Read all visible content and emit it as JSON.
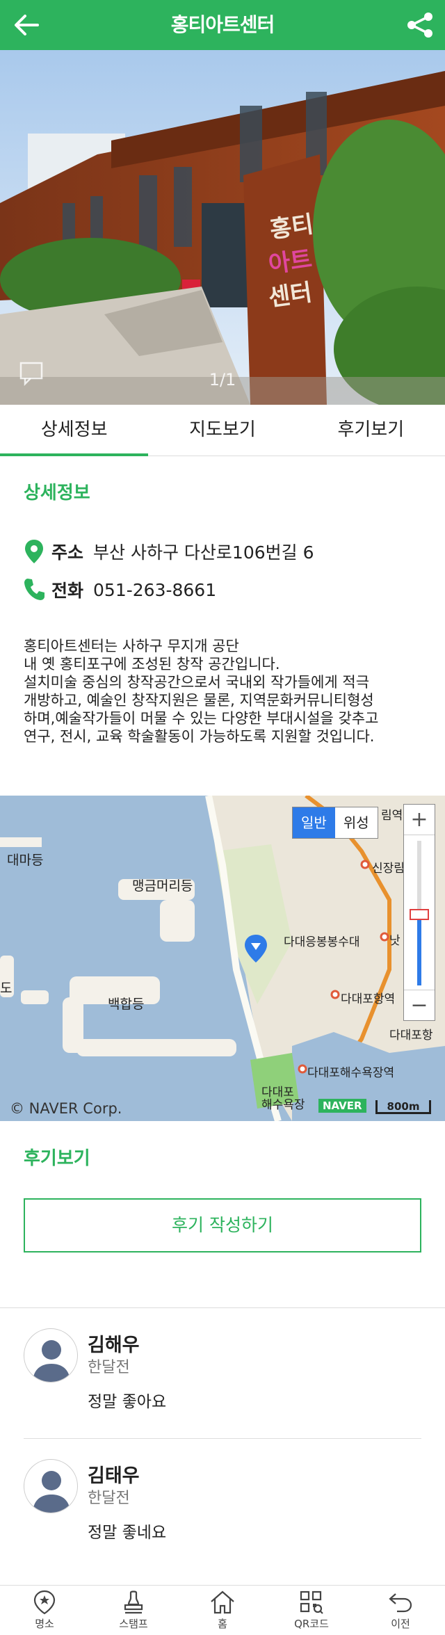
{
  "header": {
    "title": "홍티아트센터"
  },
  "hero": {
    "counter": "1/1",
    "sign_text": "홍티아트센터"
  },
  "tabs": [
    {
      "label": "상세정보"
    },
    {
      "label": "지도보기"
    },
    {
      "label": "후기보기"
    }
  ],
  "detail": {
    "section_title": "상세정보",
    "address_label": "주소",
    "address": "부산 사하구 다산로106번길 6",
    "phone_label": "전화",
    "phone": "051-263-8661",
    "description": "홍티아트센터는 사하구 무지개 공단\n내 옛 홍티포구에 조성된 창작 공간입니다.\n설치미술 중심의 창작공간으로서 국내외 작가들에게 적극\n개방하고, 예술인 창작지원은 물론, 지역문화커뮤니티형성\n하며,예술작가들이 머물 수 있는 다양한 부대시설을 갖추고\n연구, 전시, 교육 학술활동이 가능하도록 지원할 것입니다."
  },
  "map": {
    "toggle_normal": "일반",
    "toggle_satellite": "위성",
    "labels": {
      "daemado": "대마등",
      "maenggeum": "맹금머리등",
      "baekhap": "백합등",
      "do": "도",
      "bongsu": "다대응봉봉수대",
      "port": "다대포항역",
      "port2": "다대포항",
      "beach_station": "다대포해수욕장역",
      "beach": "다대포\n해수욕장",
      "sinjang": "신장림",
      "rimyeok": "림역",
      "nat": "낫"
    },
    "copyright": "© NAVER Corp.",
    "naver": "NAVER",
    "scale": "800m"
  },
  "reviews": {
    "section_title": "후기보기",
    "write_button": "후기 작성하기",
    "items": [
      {
        "name": "김해우",
        "time": "한달전",
        "text": "정말 좋아요"
      },
      {
        "name": "김태우",
        "time": "한달전",
        "text": "정말 좋네요"
      }
    ]
  },
  "bottom_nav": [
    {
      "label": "명소",
      "icon": "star-pin-icon"
    },
    {
      "label": "스탬프",
      "icon": "stamp-icon"
    },
    {
      "label": "홈",
      "icon": "home-icon"
    },
    {
      "label": "QR코드",
      "icon": "qr-icon"
    },
    {
      "label": "이전",
      "icon": "back-arrow-icon"
    }
  ],
  "colors": {
    "accent": "#2db35d",
    "map_water": "#9fbcd8",
    "map_toggle_active": "#2e7be8"
  }
}
